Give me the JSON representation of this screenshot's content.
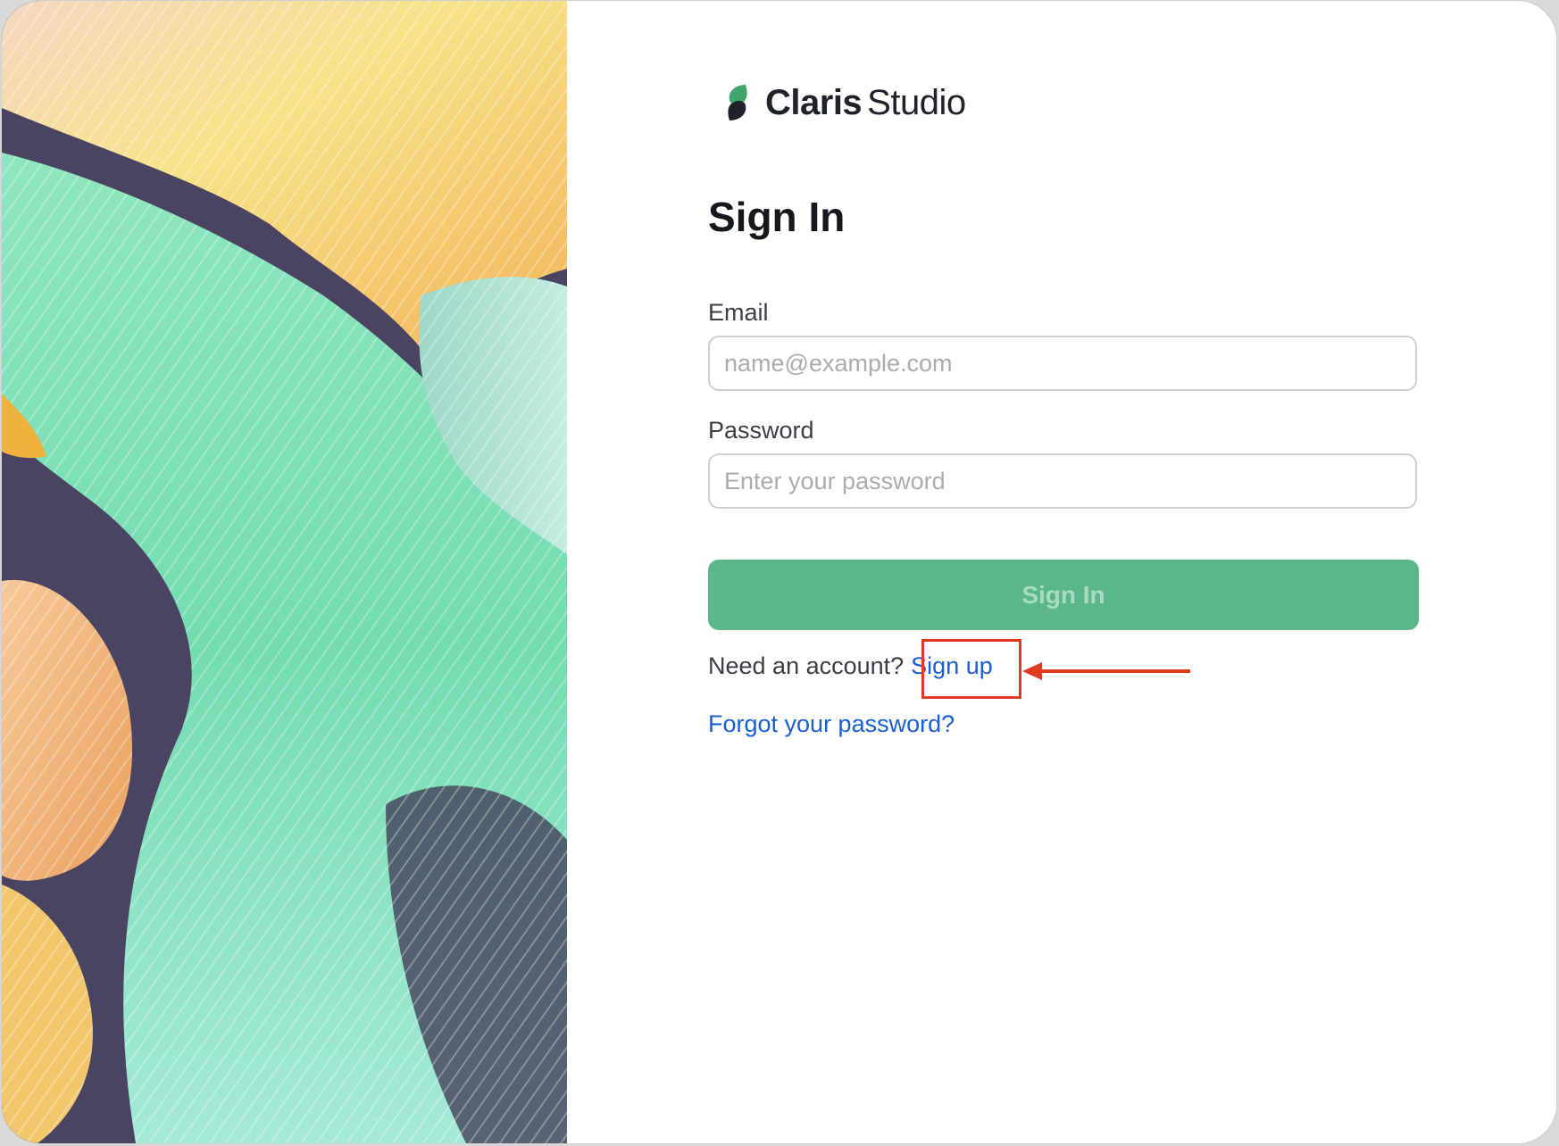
{
  "brand": {
    "name": "Claris",
    "product": "Studio",
    "logo_icon": "claris-leaf-icon",
    "logo_color": "#3fa66b"
  },
  "form": {
    "title": "Sign In",
    "email": {
      "label": "Email",
      "placeholder": "name@example.com",
      "value": ""
    },
    "password": {
      "label": "Password",
      "placeholder": "Enter your password",
      "value": ""
    },
    "submit_label": "Sign In",
    "signup_prompt": "Need an account?",
    "signup_link": "Sign up",
    "forgot_link": "Forgot your password?"
  },
  "colors": {
    "accent_button": "#5bb68a",
    "link": "#1a5fcf",
    "annotation": "#e23a22"
  },
  "annotation": {
    "target": "Sign up",
    "shape": "rectangle-with-arrow"
  }
}
